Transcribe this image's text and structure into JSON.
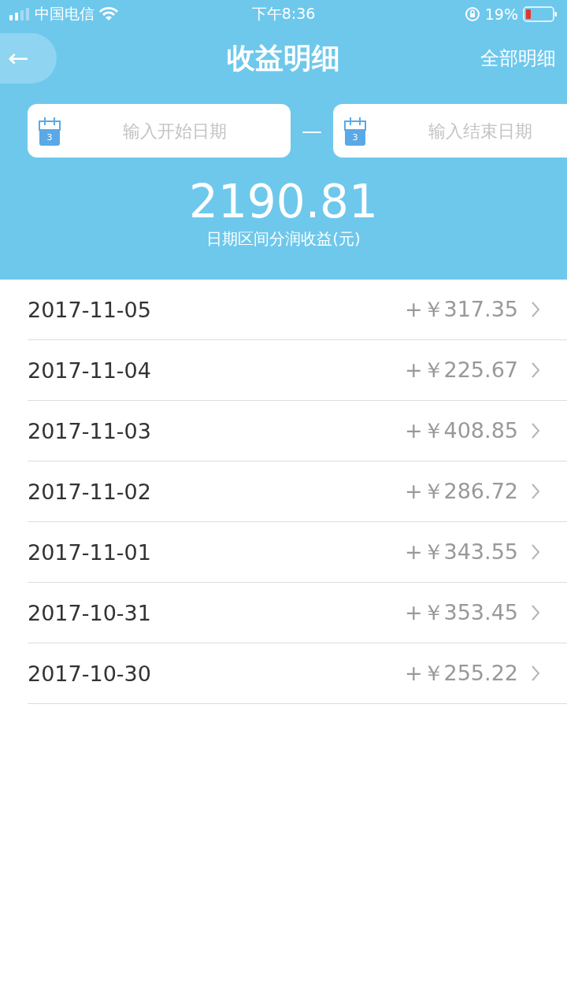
{
  "status_bar": {
    "carrier": "中国电信",
    "time": "下午8:36",
    "battery": "19%"
  },
  "nav": {
    "back": "←",
    "title": "收益明细",
    "action": "全部明细"
  },
  "date_range": {
    "start": {
      "placeholder": "输入开始日期",
      "calendar_day": "3"
    },
    "separator": "—",
    "end": {
      "placeholder": "输入结束日期",
      "calendar_day": "3"
    }
  },
  "summary": {
    "amount": "2190.81",
    "caption": "日期区间分润收益(元)"
  },
  "rows": [
    {
      "date": "2017-11-05",
      "amount": "+￥317.35"
    },
    {
      "date": "2017-11-04",
      "amount": "+￥225.67"
    },
    {
      "date": "2017-11-03",
      "amount": "+￥408.85"
    },
    {
      "date": "2017-11-02",
      "amount": "+￥286.72"
    },
    {
      "date": "2017-11-01",
      "amount": "+￥343.55"
    },
    {
      "date": "2017-10-31",
      "amount": "+￥353.45"
    },
    {
      "date": "2017-10-30",
      "amount": "+￥255.22"
    }
  ]
}
